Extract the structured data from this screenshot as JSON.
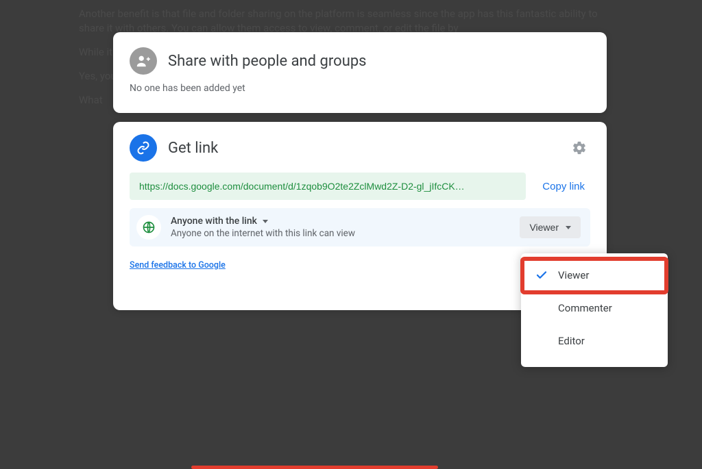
{
  "background": {
    "p1": "Another benefit is that file and folder sharing on the platform is seamless since the app has this fantastic ability to share it with others. You can allow them access to view, comment, or edit the file by",
    "p2": "While it is beneficial to share the file as it is and not as an attachment, there are apparent drawb",
    "p3": "Yes, you can share your Google files with anyone—but how do you protect it from those whom you d",
    "p4": "What"
  },
  "share": {
    "title": "Share with people and groups",
    "subtext": "No one has been added yet"
  },
  "link": {
    "title": "Get link",
    "url": "https://docs.google.com/document/d/1zqob9O2te2ZclMwd2Z-D2-gl_jIfcCK…",
    "copy_label": "Copy link",
    "scope_title": "Anyone with the link",
    "scope_desc": "Anyone on the internet with this link can view",
    "role_label": "Viewer",
    "feedback": "Send feedback to Google"
  },
  "menu": {
    "items": [
      {
        "label": "Viewer",
        "selected": true
      },
      {
        "label": "Commenter",
        "selected": false
      },
      {
        "label": "Editor",
        "selected": false
      }
    ]
  }
}
